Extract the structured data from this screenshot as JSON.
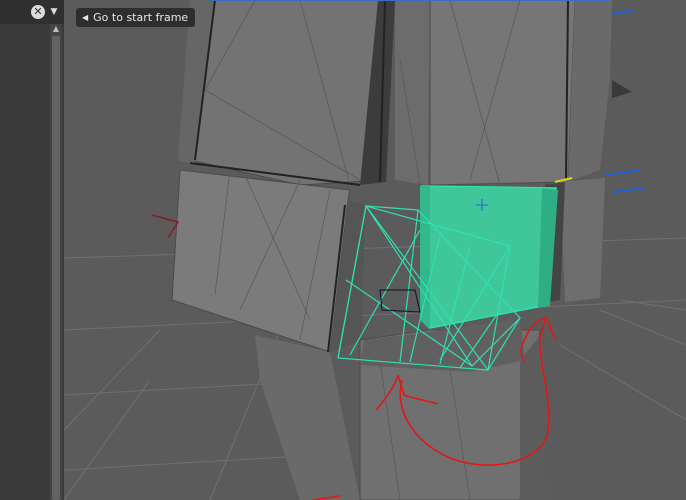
{
  "toolbar": {
    "go_to_start_label": "Go to start frame",
    "clear_icon": "close-circle-icon",
    "dropdown_icon": "chevron-down-icon",
    "back_icon": "triangle-left-icon"
  },
  "colors": {
    "viewport_background": "#5a5a5a",
    "mesh_gray": "#6f6f6f",
    "selected_face": "#3fc79a",
    "wire_teal": "#2ee0b0",
    "annotation_red": "#e01818",
    "panel_dark": "#3a3a3a"
  }
}
